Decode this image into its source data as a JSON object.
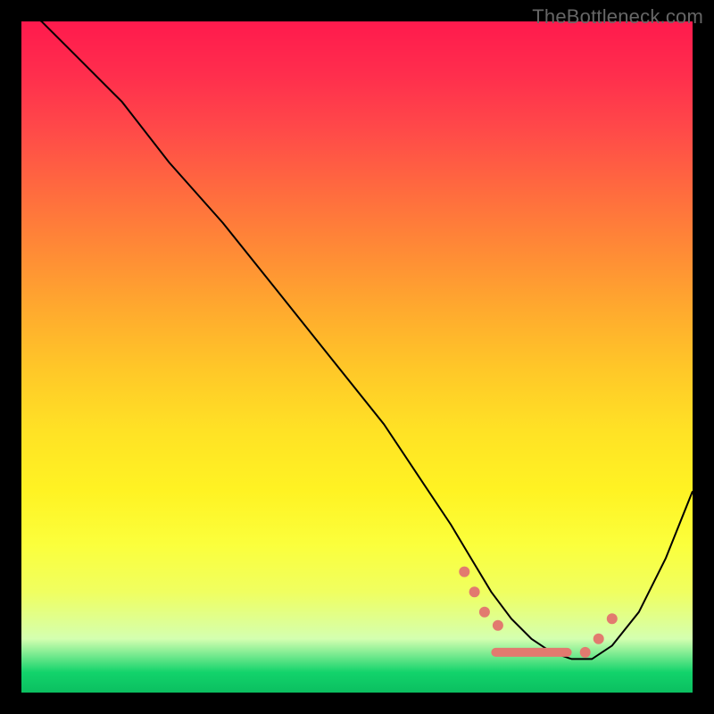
{
  "watermark": "TheBottleneck.com",
  "chart_data": {
    "type": "line",
    "title": "",
    "xlabel": "",
    "ylabel": "",
    "xlim": [
      0,
      100
    ],
    "ylim": [
      0,
      100
    ],
    "legend": false,
    "annotations": [],
    "background_gradient": {
      "direction": "vertical",
      "stops": [
        {
          "pos": 0.0,
          "color": "#ff1a4d"
        },
        {
          "pos": 0.5,
          "color": "#ffc828"
        },
        {
          "pos": 0.85,
          "color": "#f0ff60"
        },
        {
          "pos": 1.0,
          "color": "#0bbf60"
        }
      ]
    },
    "series": [
      {
        "name": "bottleneck-curve",
        "x": [
          0,
          3,
          8,
          15,
          22,
          30,
          38,
          46,
          54,
          60,
          64,
          67,
          70,
          73,
          76,
          79,
          82,
          85,
          88,
          92,
          96,
          100
        ],
        "y": [
          102,
          100,
          95,
          88,
          79,
          70,
          60,
          50,
          40,
          31,
          25,
          20,
          15,
          11,
          8,
          6,
          5,
          5,
          7,
          12,
          20,
          30
        ]
      }
    ],
    "markers": [
      {
        "name": "cluster-dot",
        "x": 66,
        "y": 18
      },
      {
        "name": "cluster-dot",
        "x": 67.5,
        "y": 15
      },
      {
        "name": "cluster-dot",
        "x": 69,
        "y": 12
      },
      {
        "name": "cluster-dot",
        "x": 71,
        "y": 10
      },
      {
        "name": "cluster-bar",
        "x": 76,
        "y": 6,
        "w": 12
      },
      {
        "name": "cluster-dot",
        "x": 84,
        "y": 6
      },
      {
        "name": "cluster-dot",
        "x": 86,
        "y": 8
      },
      {
        "name": "cluster-dot",
        "x": 88,
        "y": 11
      }
    ],
    "marker_color": "#e27a6f"
  }
}
